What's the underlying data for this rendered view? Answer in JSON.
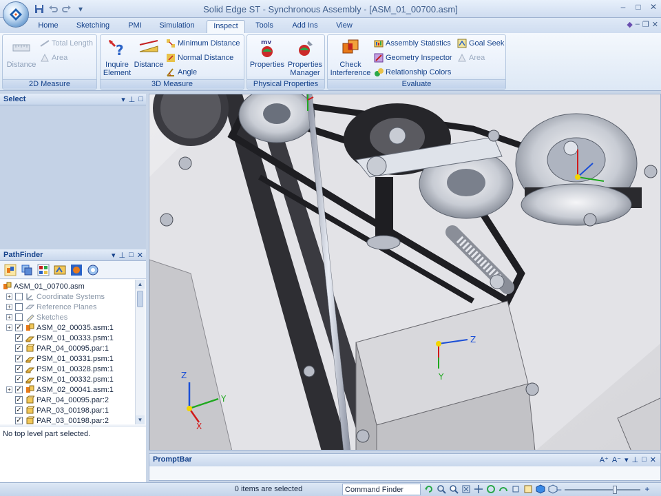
{
  "window": {
    "title": "Solid Edge ST - Synchronous Assembly - [ASM_01_00700.asm]",
    "controls": [
      "–",
      "□",
      "✕"
    ],
    "mdi_controls": [
      "–",
      "❐",
      "✕"
    ]
  },
  "quick_access": [
    "save-icon",
    "undo-icon",
    "redo-icon",
    "customize-icon"
  ],
  "tabs": [
    {
      "label": "Home",
      "active": false
    },
    {
      "label": "Sketching",
      "active": false
    },
    {
      "label": "PMI",
      "active": false
    },
    {
      "label": "Simulation",
      "active": false
    },
    {
      "label": "Inspect",
      "active": true
    },
    {
      "label": "Tools",
      "active": false
    },
    {
      "label": "Add Ins",
      "active": false
    },
    {
      "label": "View",
      "active": false
    }
  ],
  "ribbon": {
    "groups": {
      "measure2d": {
        "label": "2D Measure",
        "distance": "Distance",
        "total_length": "Total Length",
        "area": "Area"
      },
      "measure3d": {
        "label": "3D Measure",
        "inquire_line1": "Inquire",
        "inquire_line2": "Element",
        "distance": "Distance",
        "minimum_distance": "Minimum Distance",
        "normal_distance": "Normal Distance",
        "angle": "Angle"
      },
      "physical": {
        "label": "Physical Properties",
        "properties": "Properties",
        "properties_manager_line1": "Properties",
        "properties_manager_line2": "Manager"
      },
      "evaluate": {
        "label": "Evaluate",
        "check_line1": "Check",
        "check_line2": "Interference",
        "assembly_statistics": "Assembly Statistics",
        "geometry_inspector": "Geometry Inspector",
        "relationship_colors": "Relationship Colors",
        "goal_seek": "Goal Seek",
        "area": "Area"
      }
    }
  },
  "select_pane": {
    "title": "Select"
  },
  "pathfinder": {
    "title": "PathFinder",
    "root": "ASM_01_00700.asm",
    "items": [
      {
        "label": "Coordinate Systems",
        "expander": "+",
        "checked": false,
        "dim": true,
        "icon": "coordinate-system-icon"
      },
      {
        "label": "Reference Planes",
        "expander": "+",
        "checked": false,
        "dim": true,
        "icon": "reference-plane-icon"
      },
      {
        "label": "Sketches",
        "expander": "+",
        "checked": false,
        "dim": true,
        "icon": "sketch-icon"
      },
      {
        "label": "ASM_02_00035.asm:1",
        "expander": "+",
        "checked": true,
        "dim": false,
        "icon": "assembly-icon"
      },
      {
        "label": "PSM_01_00333.psm:1",
        "expander": "",
        "checked": true,
        "dim": false,
        "icon": "sheetmetal-part-icon"
      },
      {
        "label": "PAR_04_00095.par:1",
        "expander": "",
        "checked": true,
        "dim": false,
        "icon": "part-icon"
      },
      {
        "label": "PSM_01_00331.psm:1",
        "expander": "",
        "checked": true,
        "dim": false,
        "icon": "sheetmetal-part-icon"
      },
      {
        "label": "PSM_01_00328.psm:1",
        "expander": "",
        "checked": true,
        "dim": false,
        "icon": "sheetmetal-part-icon"
      },
      {
        "label": "PSM_01_00332.psm:1",
        "expander": "",
        "checked": true,
        "dim": false,
        "icon": "sheetmetal-part-icon"
      },
      {
        "label": "ASM_02_00041.asm:1",
        "expander": "+",
        "checked": true,
        "dim": false,
        "icon": "assembly-icon"
      },
      {
        "label": "PAR_04_00095.par:2",
        "expander": "",
        "checked": true,
        "dim": false,
        "icon": "part-icon"
      },
      {
        "label": "PAR_03_00198.par:1",
        "expander": "",
        "checked": true,
        "dim": false,
        "icon": "part-icon"
      },
      {
        "label": "PAR_03_00198.par:2",
        "expander": "",
        "checked": true,
        "dim": false,
        "icon": "part-icon"
      }
    ],
    "info_text": "No top level part selected."
  },
  "viewport": {
    "axis_labels": {
      "x": "X",
      "y": "Y",
      "z": "Z"
    }
  },
  "promptbar": {
    "title": "PromptBar"
  },
  "statusbar": {
    "message": "0 items are selected",
    "command_finder": "Command Finder"
  },
  "colors": {
    "accent": "#15428b",
    "ribbon_bg": "#dde8f5",
    "axis_x": "#d11a1a",
    "axis_y": "#1fa81f",
    "axis_z": "#1b4fd6",
    "origin": "#f2d600"
  }
}
